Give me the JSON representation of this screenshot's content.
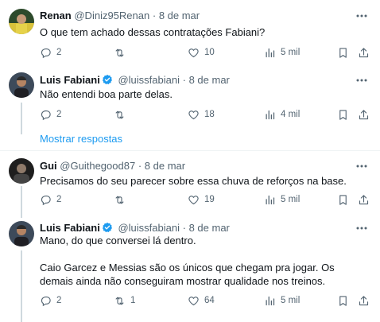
{
  "tweets": [
    {
      "name": "Renan",
      "handle": "@Diniz95Renan",
      "date": "8 de mar",
      "text": [
        "O que tem achado dessas contratações Fabiani?"
      ],
      "replies": "2",
      "retweets": "",
      "likes": "10",
      "views": "5 mil"
    },
    {
      "name": "Luis Fabiani",
      "handle": "@luissfabiani",
      "date": "8 de mar",
      "text": [
        "Não entendi boa parte delas."
      ],
      "replies": "2",
      "retweets": "",
      "likes": "18",
      "views": "4 mil"
    },
    {
      "name": "Gui",
      "handle": "@Guithegood87",
      "date": "8 de mar",
      "text": [
        "Precisamos do seu parecer sobre essa chuva de reforços na base."
      ],
      "replies": "2",
      "retweets": "",
      "likes": "19",
      "views": "5 mil"
    },
    {
      "name": "Luis Fabiani",
      "handle": "@luissfabiani",
      "date": "8 de mar",
      "text": [
        "Mano, do que conversei lá dentro.",
        "Caio Garcez e Messias são os únicos que chegam pra jogar. Os demais ainda não conseguiram mostrar qualidade nos treinos."
      ],
      "replies": "2",
      "retweets": "1",
      "likes": "64",
      "views": "5 mil"
    }
  ],
  "show_replies_label": "Mostrar respostas",
  "separator_dot": "·",
  "colors": {
    "accent": "#1d9bf0",
    "secondary_text": "#536471",
    "divider": "#eff3f4"
  },
  "icons": [
    "reply-icon",
    "retweet-icon",
    "like-icon",
    "views-icon",
    "bookmark-icon",
    "share-icon",
    "more-icon",
    "verified-icon"
  ]
}
